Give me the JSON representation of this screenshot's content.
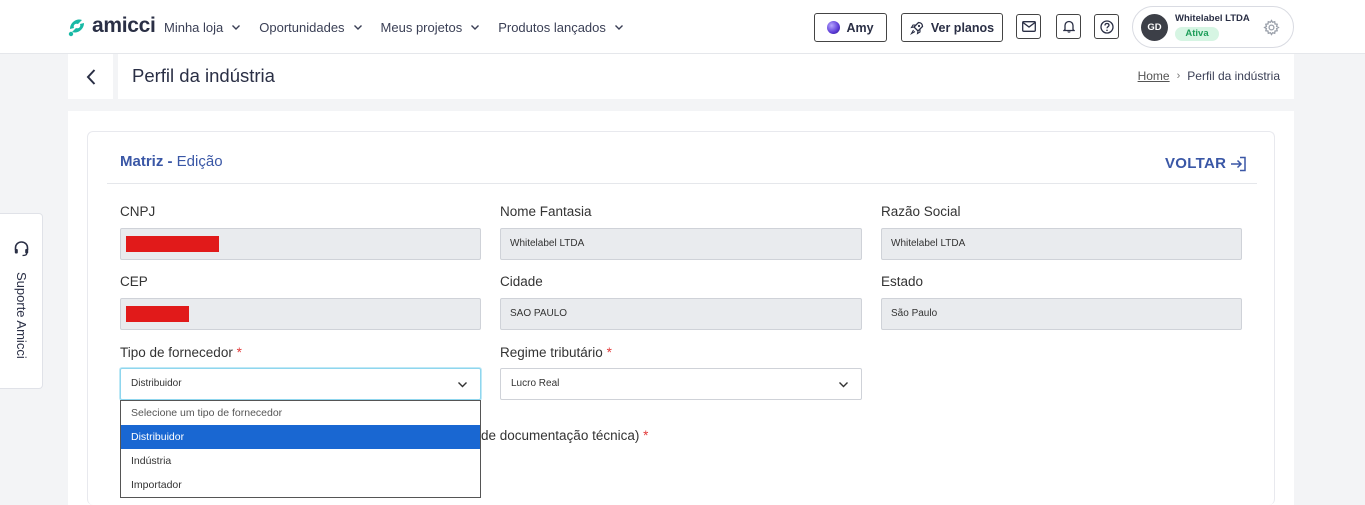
{
  "brand": {
    "name": "amicci"
  },
  "nav": [
    {
      "label": "Minha loja"
    },
    {
      "label": "Oportunidades"
    },
    {
      "label": "Meus projetos"
    },
    {
      "label": "Produtos lançados"
    }
  ],
  "actions": {
    "amy": "Amy",
    "planos": "Ver planos"
  },
  "account": {
    "initials": "GD",
    "name": "Whitelabel LTDA",
    "status": "Ativa"
  },
  "support": {
    "label": "Suporte Amicci"
  },
  "header": {
    "title": "Perfil da indústria",
    "breadcrumb": {
      "home": "Home",
      "sep": "›",
      "current": "Perfil da indústria"
    }
  },
  "section": {
    "title_bold": "Matriz -",
    "title_rest": " Edição",
    "back": "VOLTAR"
  },
  "form": {
    "cnpj_label": "CNPJ",
    "nome_label": "Nome Fantasia",
    "nome_value": "Whitelabel  LTDA",
    "razao_label": "Razão Social",
    "razao_value": "Whitelabel  LTDA",
    "cep_label": "CEP",
    "cidade_label": "Cidade",
    "cidade_value": "SAO PAULO",
    "estado_label": "Estado",
    "estado_value": "São Paulo",
    "tipo_label": "Tipo de fornecedor",
    "tipo_value": "Distribuidor",
    "regime_label": "Regime tributário",
    "regime_value": "Lucro Real",
    "required_mark": "*",
    "partial_label": "de documentação técnica)"
  },
  "dropdown": {
    "options": [
      "Selecione um tipo de fornecedor",
      "Distribuidor",
      "Indústria",
      "Importador"
    ]
  },
  "colors": {
    "accent": "#3a57a6",
    "selected": "#1967d2",
    "redaction": "#e11a1a"
  }
}
